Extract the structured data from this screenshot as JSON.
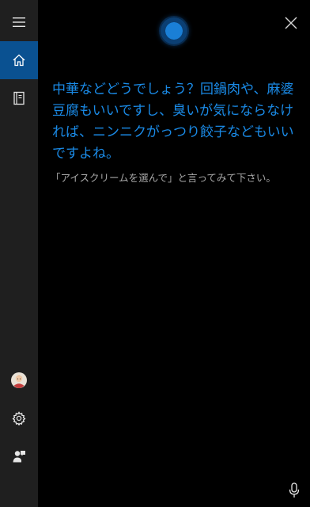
{
  "sidebar": {
    "items": [
      {
        "name": "menu",
        "icon": "hamburger-menu-icon"
      },
      {
        "name": "home",
        "icon": "home-icon",
        "active": true
      },
      {
        "name": "notebook",
        "icon": "notebook-icon"
      },
      {
        "name": "account",
        "icon": "avatar"
      },
      {
        "name": "settings",
        "icon": "gear-icon"
      },
      {
        "name": "feedback",
        "icon": "feedback-icon"
      }
    ]
  },
  "assistant": {
    "response_text": "中華などどうでしょう？回鍋肉や、麻婆豆腐もいいですし、臭いが気にならなければ、ニンニクがっつり餃子などもいいですよね。",
    "hint_text": "「アイスクリームを選んで」と言ってみて下さい。"
  },
  "colors": {
    "accent": "#1a8ae6",
    "active_sidebar": "#0a5191",
    "sidebar_bg": "#1f1f1f",
    "background": "#000000",
    "hint_text": "#a6a6a6"
  },
  "icons": [
    "hamburger-menu-icon",
    "home-icon",
    "notebook-icon",
    "gear-icon",
    "feedback-icon",
    "close-icon",
    "microphone-icon",
    "cortana-orb"
  ]
}
